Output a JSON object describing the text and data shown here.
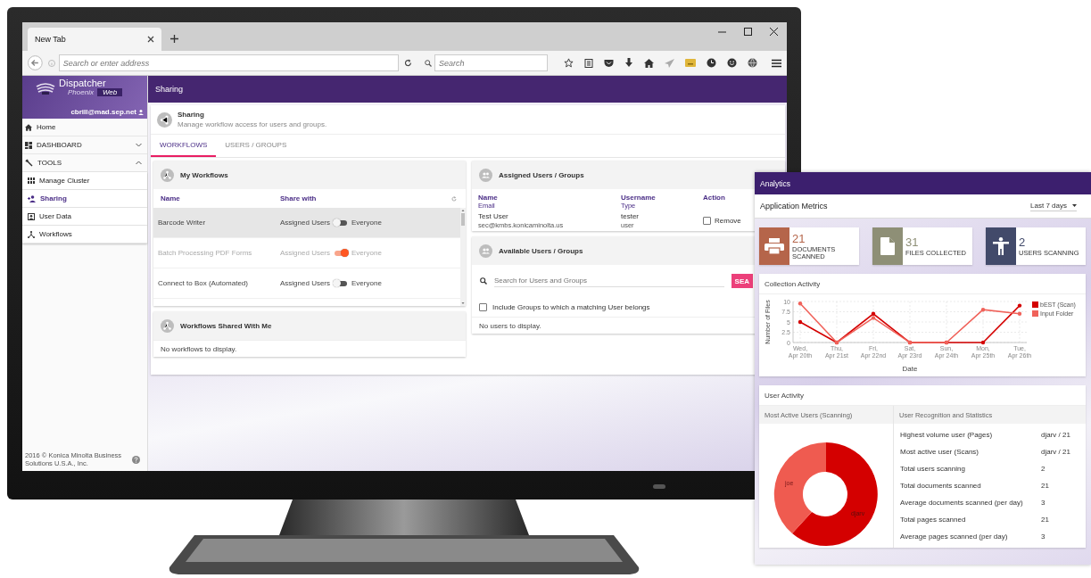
{
  "browser": {
    "tab": {
      "title": "New Tab"
    },
    "address": {
      "placeholder": "Search or enter address"
    },
    "search": {
      "placeholder": "Search"
    }
  },
  "app": {
    "logo": {
      "name": "Dispatcher",
      "sub": "Phoenix",
      "badge": "Web"
    },
    "user": "cbrill@mad.sep.net",
    "nav": [
      {
        "label": "Home",
        "kind": "link",
        "selected": false
      },
      {
        "label": "DASHBOARD",
        "kind": "section",
        "expanded": false
      },
      {
        "label": "TOOLS",
        "kind": "section",
        "expanded": true
      },
      {
        "label": "Manage Cluster",
        "kind": "sub",
        "selected": false
      },
      {
        "label": "Sharing",
        "kind": "sub",
        "selected": true
      },
      {
        "label": "User Data",
        "kind": "sub",
        "selected": false
      },
      {
        "label": "Workflows",
        "kind": "sub",
        "selected": false
      }
    ],
    "footer": "2016 © Konica Minolta Business Solutions U.S.A., Inc.",
    "header_title": "Sharing",
    "page": {
      "title": "Sharing",
      "subtitle": "Manage workflow access for users and groups."
    },
    "tabs": [
      {
        "label": "WORKFLOWS",
        "selected": true
      },
      {
        "label": "USERS / GROUPS",
        "selected": false
      }
    ],
    "my_workflows": {
      "title": "My Workflows",
      "columns": [
        "Name",
        "Share with"
      ],
      "rows": [
        {
          "name": "Barcode Writer",
          "left": "Assigned Users",
          "right": "Everyone",
          "on": false,
          "disabled": false,
          "selected": true
        },
        {
          "name": "Batch Processing PDF Forms",
          "left": "Assigned Users",
          "right": "Everyone",
          "on": true,
          "disabled": true,
          "selected": false
        },
        {
          "name": "Connect to Box (Automated)",
          "left": "Assigned Users",
          "right": "Everyone",
          "on": false,
          "disabled": false,
          "selected": false
        }
      ]
    },
    "shared": {
      "title": "Workflows Shared With Me",
      "empty": "No workflows to display."
    },
    "assigned": {
      "title": "Assigned Users / Groups",
      "columns": [
        {
          "top": "Name",
          "bottom": "Email"
        },
        {
          "top": "Username",
          "bottom": "Type"
        },
        {
          "top": "Action"
        }
      ],
      "rows": [
        {
          "name": "Test User",
          "email": "sec@kmbs.konicaminolta.us",
          "username": "tester",
          "type": "user",
          "action": "Remove",
          "checked": false
        }
      ]
    },
    "available": {
      "title": "Available Users / Groups",
      "search": {
        "placeholder": "Search for Users and Groups"
      },
      "button": "SEA",
      "include": {
        "label": "Include Groups to which a matching User belongs",
        "checked": false
      },
      "empty": "No users to display."
    }
  },
  "analytics": {
    "title": "Analytics",
    "section": "Application Metrics",
    "range": "Last 7 days",
    "stats": [
      {
        "value": "21",
        "label": "DOCUMENTS SCANNED",
        "color": "#b5654a",
        "kind": "printer"
      },
      {
        "value": "31",
        "label": "FILES COLLECTED",
        "color": "#8e8f76",
        "kind": "file"
      },
      {
        "value": "2",
        "label": "USERS SCANNING",
        "color": "#424a6a",
        "kind": "person"
      }
    ],
    "collection": {
      "title": "Collection Activity",
      "chart_data": {
        "type": "line",
        "xlabel": "Date",
        "ylabel": "Number of Files",
        "grid": true,
        "legend": "right",
        "categories": [
          "Wed, Apr 20th",
          "Thu, Apr 21st",
          "Fri, Apr 22nd",
          "Sat, Apr 23rd",
          "Sun, Apr 24th",
          "Mon, Apr 25th",
          "Tue, Apr 26th"
        ],
        "ylim": [
          0,
          10
        ],
        "yticks": [
          0,
          2.5,
          5,
          7.5,
          10
        ],
        "series": [
          {
            "name": "bEST (Scan)",
            "color": "#d40000",
            "values": [
              5,
              0,
              7,
              0,
              0,
              0,
              9
            ]
          },
          {
            "name": "Input Folder",
            "color": "#f0625a",
            "values": [
              9.5,
              0,
              6,
              0,
              0,
              8,
              7
            ]
          }
        ]
      }
    },
    "user_activity": {
      "title": "User Activity",
      "left_heading": "Most Active Users (Scanning)",
      "right_heading": "User Recognition and Statistics",
      "slice_labels": [
        "joe",
        "djarv"
      ],
      "stats": [
        {
          "label": "Highest volume user (Pages)",
          "value": "djarv / 21"
        },
        {
          "label": "Most active user (Scans)",
          "value": "djarv / 21"
        },
        {
          "label": "Total users scanning",
          "value": "2"
        },
        {
          "label": "Total documents scanned",
          "value": "21"
        },
        {
          "label": "Average documents scanned (per day)",
          "value": "3"
        },
        {
          "label": "Total pages scanned",
          "value": "21"
        },
        {
          "label": "Average pages scanned (per day)",
          "value": "3"
        }
      ]
    }
  }
}
